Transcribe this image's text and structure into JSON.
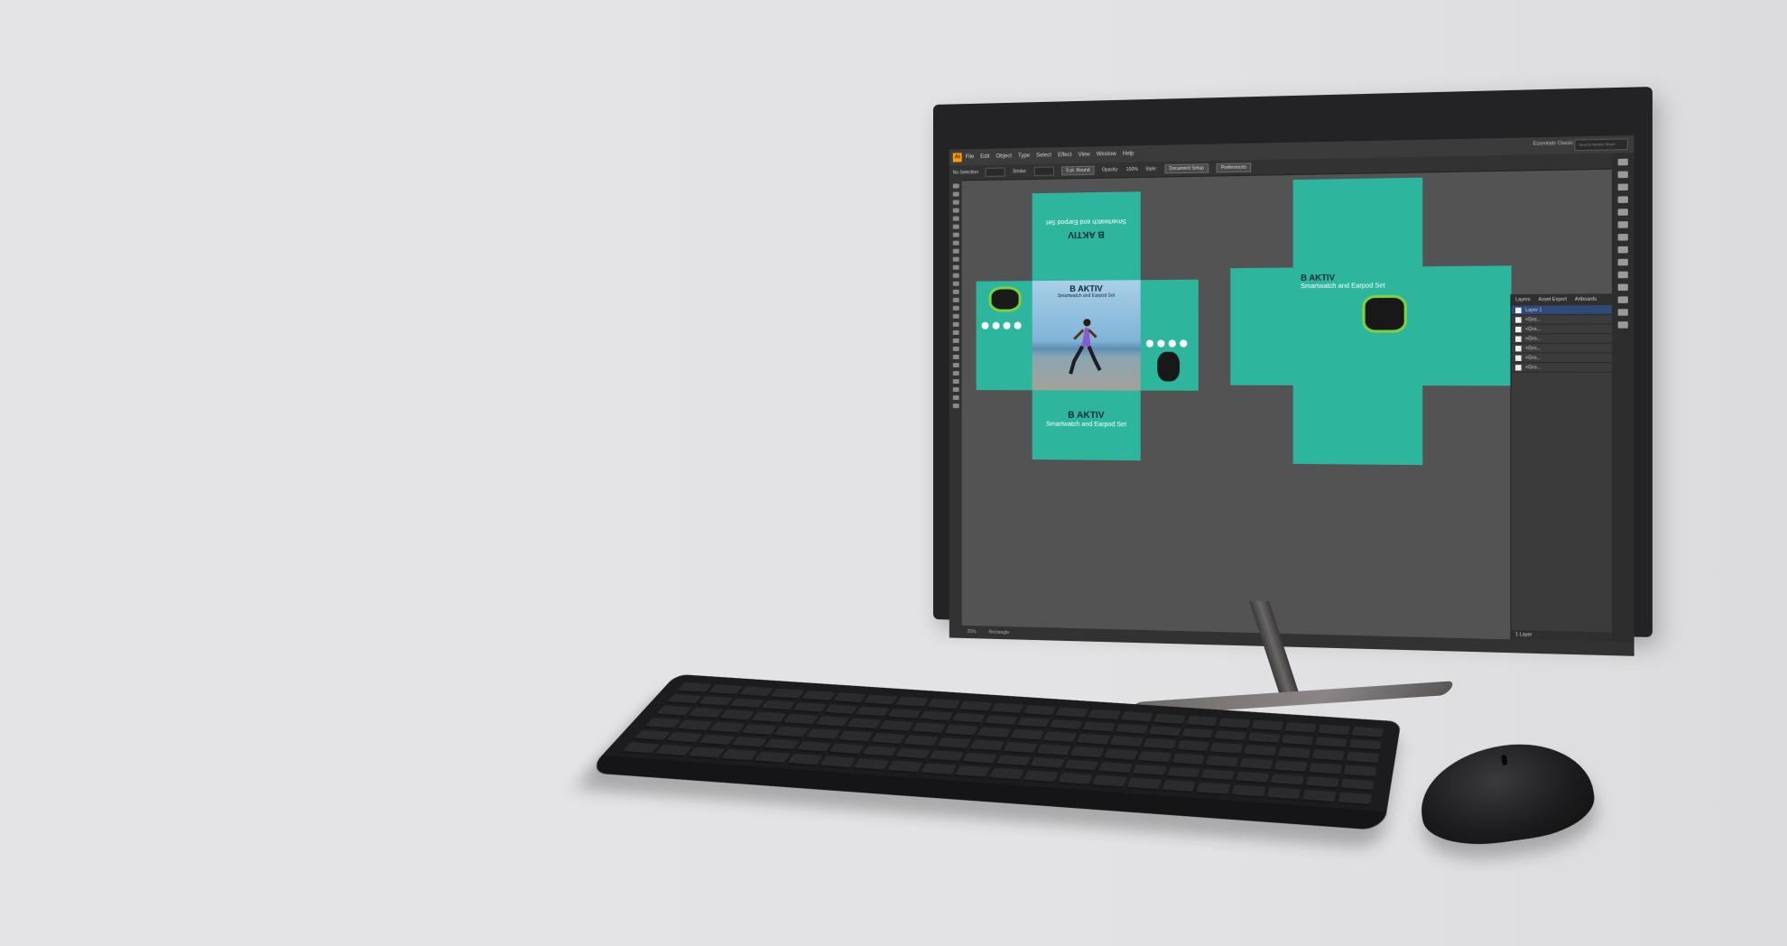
{
  "app": {
    "menu": [
      "File",
      "Edit",
      "Object",
      "Type",
      "Select",
      "Effect",
      "View",
      "Window",
      "Help"
    ],
    "logo": "Ai",
    "workspace": "Essentials Classic",
    "search_placeholder": "Search Adobe Stock",
    "control": {
      "selection": "No Selection",
      "stroke": "Stroke:",
      "uniform": "5 pt. Round",
      "opacity": "Opacity:",
      "opacity_value": "100%",
      "style": "Style:",
      "doc_setup": "Document Setup",
      "preferences": "Preferences"
    },
    "status": {
      "zoom": "25%",
      "tool": "Rectangle"
    }
  },
  "artwork": {
    "brand": "B AKTIV",
    "tagline": "Smartwatch and Earpod Set"
  },
  "layers_panel": {
    "tabs": [
      "Layers",
      "Asset Export",
      "Artboards"
    ],
    "top_layer": "Layer 1",
    "rows": [
      "<Gro...",
      "<Gro...",
      "<Gro...",
      "<Gro...",
      "<Gro...",
      "<Gro..."
    ],
    "footer": "1 Layer"
  },
  "colors": {
    "teal": "#2db59e",
    "background": "#e3e3e5",
    "canvas": "#535353"
  }
}
